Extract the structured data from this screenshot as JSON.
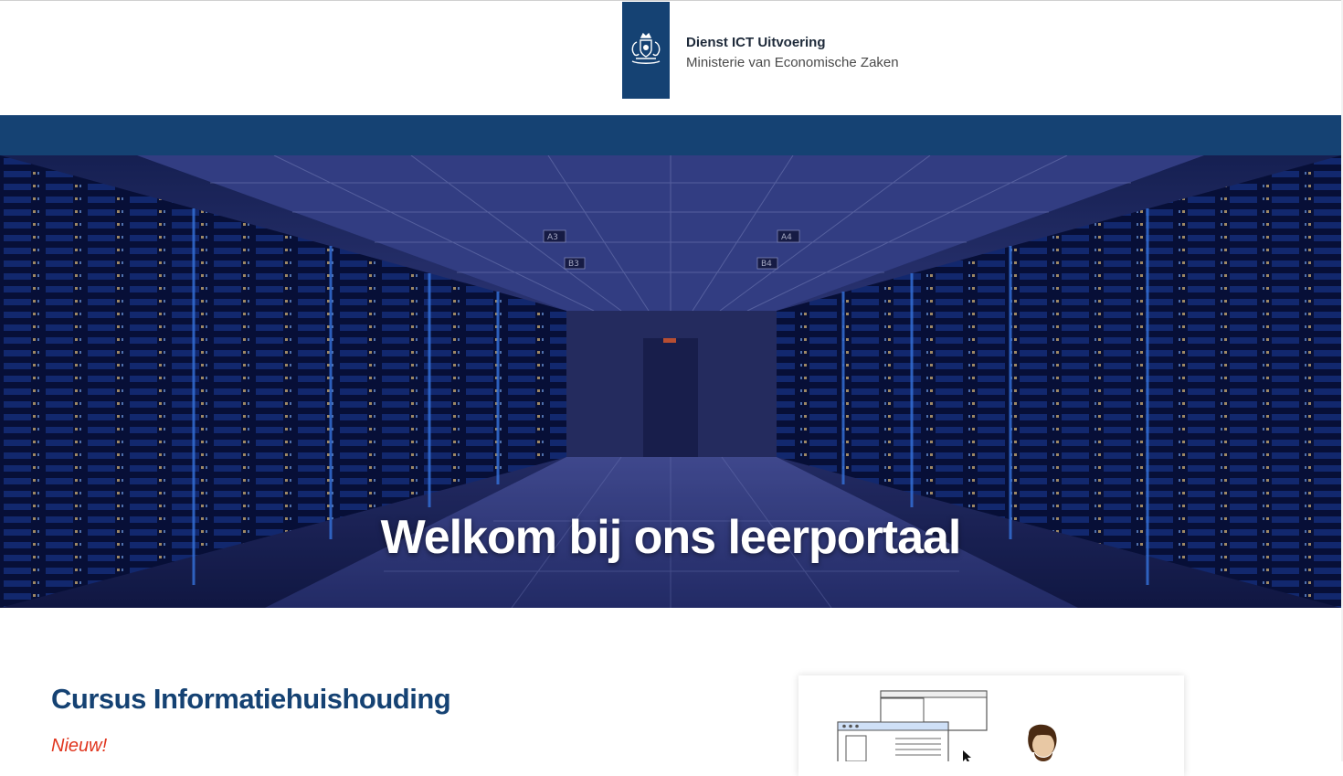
{
  "header": {
    "org_name": "Dienst ICT Uitvoering",
    "ministry": "Ministerie van Economische Zaken",
    "brand_color": "#154273"
  },
  "hero": {
    "title": "Welkom bij ons leerportaal",
    "signs": [
      "A3",
      "A4",
      "B3",
      "B4"
    ]
  },
  "course": {
    "title": "Cursus Informatiehuishouding",
    "badge": "Nieuw!",
    "badge_color": "#e0351e"
  },
  "icons": {
    "logo": "rijksoverheid-coat-of-arms-icon",
    "course_illustration": "browser-windows-with-person-icon"
  }
}
